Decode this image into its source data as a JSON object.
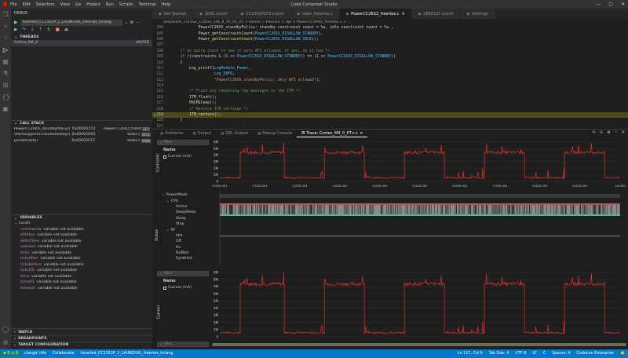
{
  "titlebar": {
    "menu": [
      "File",
      "Edit",
      "Selection",
      "View",
      "Go",
      "Project",
      "Run",
      "Scripts",
      "Terminal",
      "Help"
    ],
    "title": "Code Composer Studio",
    "controls": [
      "—",
      "▢",
      "✕"
    ]
  },
  "sidebar": {
    "header": "DEBUG",
    "launch_config": "timerled_CC1352P_2_LAUNCHXL_freertos_ticlang",
    "threads_title": "THREADS",
    "thread_name": "Cortex_M4_0",
    "thread_state": "HALTED",
    "callstack_title": "CALL STACK",
    "callstack": [
      {
        "fn": "PowerCC26XX_standbyPolicy()",
        "addr": "0x00001512",
        "file": "PowerCC26X2_freertos.c",
        "line": "117"
      },
      {
        "fn": "vPortSuppressTicksAndSleep()",
        "addr": "0x00002D02",
        "file": "tasks.c",
        "line": "3511"
      },
      {
        "fn": "prvIdleTask()",
        "addr": "0x00002CFC",
        "file": "tasks.c",
        "line": "3549"
      }
    ],
    "variables_title": "VARIABLES",
    "locals_label": "Locals",
    "variables": [
      {
        "name": "constraints:",
        "value": "variable not available"
      },
      {
        "name": "eStatus:",
        "value": "variable not available"
      },
      {
        "name": "deltaTime:",
        "value": "variable not available"
      },
      {
        "name": "soonest:",
        "value": "variable not available"
      },
      {
        "name": "ticks:",
        "value": "variable not available"
      },
      {
        "name": "ticksAfter:",
        "value": "variable not available"
      },
      {
        "name": "ticksBefore:",
        "value": "variable not available"
      },
      {
        "name": "ticksOS:",
        "value": "variable not available"
      },
      {
        "name": "time:",
        "value": "variable not available"
      },
      {
        "name": "timeOS:",
        "value": "variable not available"
      },
      {
        "name": "timeout:",
        "value": "variable not available"
      }
    ],
    "watch_title": "WATCH",
    "breakpoints_title": "BREAKPOINTS",
    "target_title": "TARGET CONFIGURATION"
  },
  "tabs": [
    {
      "label": "Get Started",
      "active": false
    },
    {
      "label": "1642.ccxml",
      "active": false
    },
    {
      "label": "CC1352P1F3.ccxml",
      "active": false
    },
    {
      "label": "main_freertos.c",
      "active": false
    },
    {
      "label": "PowerCC26X2_freertos.c",
      "active": true
    },
    {
      "label": "2800137.ccxml",
      "active": false
    },
    {
      "label": "Settings",
      "active": false
    }
  ],
  "breadcrumb": "simplelink_cc13xx_cc26xx_sdk_8_30_01_01  >  kernel  >  freertos  >  dpl  >  PowerCC26X2_freertos.c  >  ...",
  "code_lines": [
    {
      "n": "",
      "t": "            PowerCC26XX_standbyPolicy: standby constraint count = %u, idle constraint count = %u ,"
    },
    {
      "n": "",
      "t": "            Power_getConstraintCount(PowerCC26XX_DISALLOW_STANDBY),"
    },
    {
      "n": "",
      "t": "            Power_getConstraintCount(PowerCC26XX_DISALLOW_IDLE));"
    },
    {
      "n": "",
      "t": ""
    },
    {
      "n": "",
      "t": "    /* do quick check to see if only WFI allowed; if yes, do it now */"
    },
    {
      "n": "",
      "t": "    if ((constraints & (1 << PowerCC26XX_DISALLOW_STANDBY)) == (1 << PowerCC26XX_DISALLOW_STANDBY))"
    },
    {
      "n": "",
      "t": "    {"
    },
    {
      "n": "",
      "t": "        Log_printf(LogModule_Power,"
    },
    {
      "n": "",
      "t": "                   Log_INFO,"
    },
    {
      "n": "",
      "t": "                   \"PowerCC26XX_standbyPolicy: Only WFI allowed\");"
    },
    {
      "n": "",
      "t": ""
    },
    {
      "n": "",
      "t": "        /* Flush any remaining log messages in the ITM */"
    },
    {
      "n": "",
      "t": "        ITM_flush();"
    },
    {
      "n": "",
      "t": "        PRCMSleep();"
    },
    {
      "n": "",
      "t": "        /* Restore ITM settings */"
    },
    {
      "n": "117",
      "t": "        ITM_restore();"
    },
    {
      "n": "",
      "t": "    }"
    },
    {
      "n": "",
      "t": ""
    },
    {
      "n": "",
      "t": "    /*"
    },
    {
      "n": "",
      "t": "     * check if any sleep modes are allowed for automatic activation"
    }
  ],
  "line_numbers": [
    "104",
    "105",
    "106",
    "107",
    "108",
    "109",
    "110",
    "111",
    "112",
    "113",
    "114",
    "115",
    "116",
    "117",
    "118",
    "119",
    "120",
    "121",
    "122",
    "123"
  ],
  "current_line_index": 15,
  "panel": {
    "tabs": [
      {
        "label": "Problems",
        "active": false
      },
      {
        "label": "Output",
        "active": false
      },
      {
        "label": "GEL Output",
        "active": false
      },
      {
        "label": "Debug Console",
        "active": false
      },
      {
        "label": "Trace: Cortex_M4_0_ET++",
        "active": true
      }
    ],
    "filter_placeholder": "Filter",
    "name_header": "Name",
    "current_series": "Current (mA)",
    "top_chart_label": "Controller",
    "mid_chart_label": "States",
    "bottom_chart_label": "Current",
    "states": [
      {
        "label": "PowerMode",
        "indent": 0,
        "expand": true
      },
      {
        "label": "CPU",
        "indent": 1,
        "expand": true
      },
      {
        "label": "Active",
        "indent": 2,
        "expand": false
      },
      {
        "label": "DeepSleep",
        "indent": 2,
        "expand": false
      },
      {
        "label": "Sleep",
        "indent": 2,
        "expand": false
      },
      {
        "label": "Stop",
        "indent": 2,
        "expand": false
      },
      {
        "label": "RF",
        "indent": 1,
        "expand": true
      },
      {
        "label": "Idle",
        "indent": 2,
        "expand": false
      },
      {
        "label": "Off",
        "indent": 2,
        "expand": false
      },
      {
        "label": "Rx",
        "indent": 2,
        "expand": false
      },
      {
        "label": "RxWait",
        "indent": 2,
        "expand": false
      },
      {
        "label": "SynthAct",
        "indent": 2,
        "expand": false
      }
    ],
    "time_ticks": [
      "0.000 001",
      "1.000 001",
      "2.000 001",
      "3.000 001",
      "4.000 001",
      "5.000 001",
      "6.000 001",
      "7.000 001",
      "8.000 001",
      "9.000 001",
      "10.000"
    ],
    "top_y_ticks": [
      "6M",
      "5M",
      "4M",
      "3M",
      "2M",
      "1M",
      "0"
    ],
    "bottom_y_ticks": [
      "9M",
      "8M",
      "7M",
      "6M",
      "5M",
      "4M",
      "3M",
      "2M",
      "1M",
      "0"
    ]
  },
  "chart_data": [
    {
      "type": "line",
      "title": "",
      "xlabel": "",
      "ylabel": "Controller",
      "series": [
        {
          "name": "Current (mA)",
          "color": "#e03030"
        }
      ],
      "x": [
        0,
        0.5,
        0.51,
        1.6,
        1.61,
        2.6,
        2.61,
        3.6,
        3.61,
        4.6,
        4.61,
        5.6,
        5.61,
        6.6,
        6.61,
        7.6,
        7.61,
        8.6,
        8.61,
        9.6,
        9.61,
        10.0
      ],
      "levels": [
        0.6,
        0.6,
        4.8,
        4.8,
        0.6,
        0.6,
        4.8,
        4.8,
        0.6,
        0.6,
        4.8,
        4.8,
        0.6,
        0.6,
        4.8,
        4.8,
        0.6,
        0.6,
        4.8,
        4.8,
        0.6,
        0.6
      ],
      "ylim": [
        0,
        6.5
      ]
    },
    {
      "type": "line",
      "title": "",
      "xlabel": "",
      "ylabel": "Current",
      "series": [
        {
          "name": "Current (mA)",
          "color": "#e03030"
        }
      ],
      "x": [
        0,
        0.5,
        0.51,
        1.6,
        1.61,
        2.6,
        2.61,
        3.6,
        3.61,
        4.6,
        4.61,
        5.6,
        5.61,
        6.6,
        6.61,
        7.6,
        7.61,
        8.6,
        8.61,
        9.6,
        9.61,
        10.0
      ],
      "levels": [
        0.6,
        0.6,
        7.8,
        7.8,
        0.6,
        0.6,
        7.8,
        7.8,
        0.6,
        0.6,
        7.8,
        7.8,
        0.6,
        0.6,
        7.8,
        7.8,
        0.6,
        0.6,
        7.8,
        7.8,
        0.6,
        0.6
      ],
      "ylim": [
        0,
        9.5
      ]
    }
  ],
  "statusbar": {
    "left": [
      "⊗ 0  ⚠ 0",
      "clangd: idle",
      "Collaborate",
      "timerled_CC1352P_2_LAUNCHXL_freertos_ticlang"
    ],
    "right": [
      "Ln 117, Col 9",
      "Tab Size: 4",
      "UTF-8",
      "LF",
      "C",
      "Spaces: 4",
      "Codeium Enterprise"
    ]
  },
  "colors": {
    "accent": "#007acc",
    "trace": "#e03030",
    "current_line": "#4b4b18"
  }
}
